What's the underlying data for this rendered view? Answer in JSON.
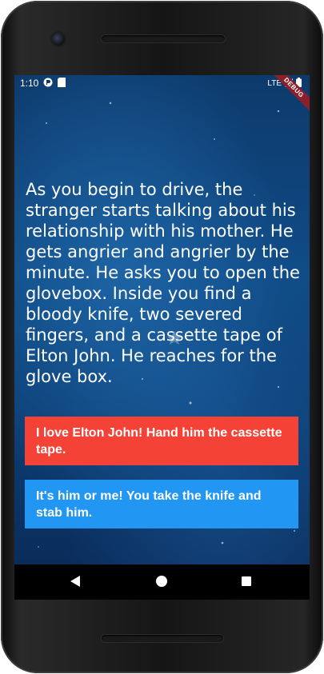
{
  "status_bar": {
    "time": "1:10",
    "network": "LTE",
    "icons": [
      "notification-icon",
      "sd-card-icon",
      "signal-icon",
      "battery-icon"
    ]
  },
  "debug_banner": {
    "label": "DEBUG"
  },
  "story": {
    "text": "As you begin to drive, the stranger starts talking about his relationship with his mother. He gets angrier and angrier by the minute. He asks you to open the glovebox. Inside you find a bloody knife, two severed fingers, and a cassette tape of Elton John. He reaches for the glove box."
  },
  "choices": [
    {
      "label": "I love Elton John! Hand him the cassette tape.",
      "color": "#f44336"
    },
    {
      "label": "It's him or me! You take the knife and stab him.",
      "color": "#2196f3"
    }
  ],
  "navigation": {
    "icons": [
      "back-icon",
      "home-icon",
      "recents-icon"
    ]
  },
  "colors": {
    "background": "#0f4a84",
    "choice1": "#f44336",
    "choice2": "#2196f3",
    "debug": "#8b1f2c"
  }
}
